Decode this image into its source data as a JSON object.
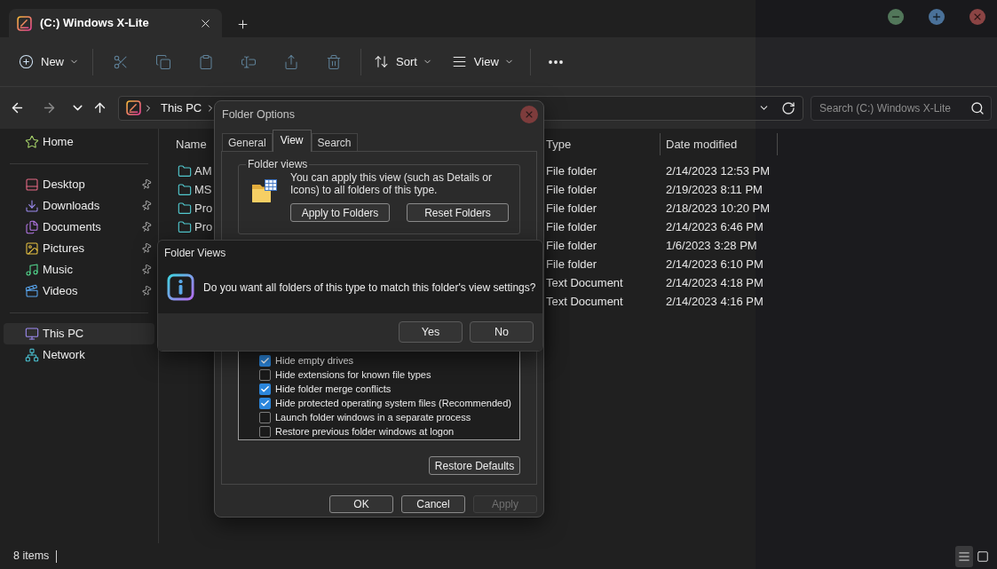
{
  "window": {
    "tab": {
      "title": "(C:) Windows X-Lite",
      "selected": true
    }
  },
  "toolbar": [
    {
      "kind": "new",
      "label": "New",
      "disabled": false
    },
    {
      "kind": "separator"
    },
    {
      "kind": "cut",
      "disabled": true
    },
    {
      "kind": "copy",
      "disabled": true
    },
    {
      "kind": "paste",
      "disabled": true
    },
    {
      "kind": "rename",
      "disabled": true
    },
    {
      "kind": "share",
      "disabled": true
    },
    {
      "kind": "delete",
      "disabled": true
    },
    {
      "kind": "separator"
    },
    {
      "kind": "sort",
      "label": "Sort",
      "disabled": false
    },
    {
      "kind": "view",
      "label": "View",
      "disabled": false
    },
    {
      "kind": "separator"
    },
    {
      "kind": "more",
      "disabled": false
    }
  ],
  "navigation": [
    {
      "kind": "back",
      "disabled": false
    },
    {
      "kind": "forward",
      "disabled": true
    },
    {
      "kind": "recent",
      "disabled": false
    },
    {
      "kind": "up",
      "disabled": false
    }
  ],
  "address": {
    "segments": [
      "This PC"
    ]
  },
  "search": {
    "placeholder": "Search (C:) Windows X-Lite"
  },
  "sidebar": {
    "groups": [
      [
        {
          "kind": "home",
          "label": "Home",
          "pinned": false,
          "selected": false
        }
      ],
      [
        {
          "kind": "desktop",
          "label": "Desktop",
          "pinned": true,
          "selected": false
        },
        {
          "kind": "downloads",
          "label": "Downloads",
          "pinned": true,
          "selected": false
        },
        {
          "kind": "documents",
          "label": "Documents",
          "pinned": true,
          "selected": false
        },
        {
          "kind": "pictures",
          "label": "Pictures",
          "pinned": true,
          "selected": false
        },
        {
          "kind": "music",
          "label": "Music",
          "pinned": true,
          "selected": false
        },
        {
          "kind": "videos",
          "label": "Videos",
          "pinned": true,
          "selected": false
        }
      ],
      [
        {
          "kind": "pc",
          "label": "This PC",
          "pinned": false,
          "selected": true
        },
        {
          "kind": "network",
          "label": "Network",
          "pinned": false,
          "selected": false
        }
      ]
    ]
  },
  "file_list": {
    "columns": [
      "Name",
      "Type",
      "Date modified"
    ],
    "rows": [
      {
        "kind": "folder",
        "name": "AM",
        "type": "File folder",
        "date_modified": "2/14/2023 12:53 PM"
      },
      {
        "kind": "folder",
        "name": "MS",
        "type": "File folder",
        "date_modified": "2/19/2023 8:11 PM"
      },
      {
        "kind": "folder",
        "name": "Pro",
        "type": "File folder",
        "date_modified": "2/18/2023 10:20 PM"
      },
      {
        "kind": "folder",
        "name": "Pro",
        "type": "File folder",
        "date_modified": "2/14/2023 6:46 PM"
      },
      {
        "type": "File folder",
        "date_modified": "1/6/2023 3:28 PM"
      },
      {
        "type": "File folder",
        "date_modified": "2/14/2023 6:10 PM"
      },
      {
        "type": "Text Document",
        "date_modified": "2/14/2023 4:18 PM"
      },
      {
        "type": "Text Document",
        "date_modified": "2/14/2023 4:16 PM"
      }
    ]
  },
  "status_bar": {
    "item_count": "8 items",
    "views": [
      {
        "kind": "details",
        "selected": true
      },
      {
        "kind": "tiles",
        "selected": false
      }
    ]
  },
  "folder_options": {
    "title": "Folder Options",
    "tabs": [
      {
        "label": "General",
        "selected": false
      },
      {
        "label": "View",
        "selected": true
      },
      {
        "label": "Search",
        "selected": false
      }
    ],
    "folder_views": {
      "legend": "Folder views",
      "text": "You can apply this view (such as Details or Icons) to all folders of this type.",
      "buttons": [
        "Apply to Folders",
        "Reset Folders"
      ]
    },
    "advanced_settings": [
      {
        "label": "Hide empty drives",
        "checked": true
      },
      {
        "label": "Hide extensions for known file types",
        "checked": false
      },
      {
        "label": "Hide folder merge conflicts",
        "checked": true
      },
      {
        "label": "Hide protected operating system files (Recommended)",
        "checked": true
      },
      {
        "label": "Launch folder windows in a separate process",
        "checked": false
      },
      {
        "label": "Restore previous folder windows at logon",
        "checked": false
      }
    ],
    "restore_button": "Restore Defaults",
    "buttons": [
      {
        "label": "OK",
        "disabled": false
      },
      {
        "label": "Cancel",
        "disabled": false
      },
      {
        "label": "Apply",
        "disabled": true
      }
    ]
  },
  "message_box": {
    "title": "Folder Views",
    "message": "Do you want all folders of this type to match this folder's view settings?",
    "buttons": [
      "Yes",
      "No"
    ]
  }
}
